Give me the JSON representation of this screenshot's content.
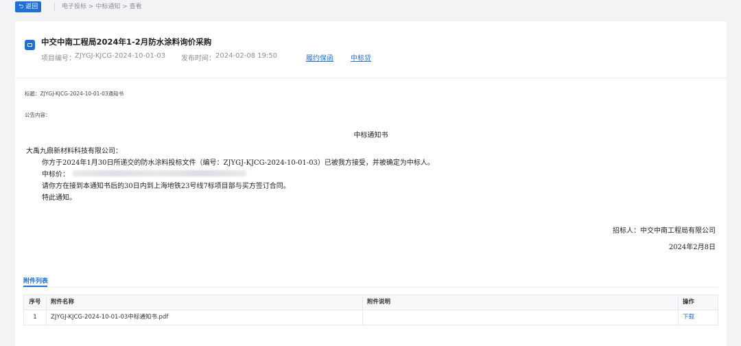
{
  "topbar": {
    "back_label": "返回",
    "breadcrumb": [
      "电子投标",
      "中标通知",
      "查看"
    ],
    "breadcrumb_sep": ">"
  },
  "header": {
    "title": "中交中南工程局2024年1-2月防水涂料询价采购",
    "project_no_label": "项目编号：",
    "project_no": "ZJYGJ-KJCG-2024-10-01-03",
    "publish_time_label": "发布时间：",
    "publish_time": "2024-02-08 19:50",
    "links": [
      "履约保函",
      "中标贷"
    ]
  },
  "notice": {
    "subject_label": "标题：",
    "subject": "ZJYGJ-KJCG-2024-10-01-03通知书",
    "content_label": "公告内容：",
    "doc_title": "中标通知书",
    "addressee": "大禹九鼎新材料科技有限公司：",
    "body_line1": "你方于2024年1月30日所递交的防水涂料投标文件（编号：ZJYGJ-KJCG-2024-10-01-03）已被我方接受，并被确定为中标人。",
    "price_label": "中标价：",
    "body_line3": "请你方在接到本通知书后的30日内到上海地铁23号线7标项目部与买方签订合同。",
    "body_line4": "特此通知。",
    "signer": "招标人：中交中南工程局有限公司",
    "date": "2024年2月8日"
  },
  "attachments": {
    "tab_label": "附件列表",
    "columns": [
      "序号",
      "附件名称",
      "附件说明",
      "操作"
    ],
    "rows": [
      {
        "index": "1",
        "name": "ZJYGJ-KJCG-2024-10-01-03中标通知书.pdf",
        "desc": "",
        "action": "下载"
      }
    ]
  },
  "colors": {
    "accent": "#1f6fd6",
    "page_bg": "#f2f3f5"
  },
  "icons": {
    "back": "return-arrow-icon",
    "header": "folder-icon"
  }
}
